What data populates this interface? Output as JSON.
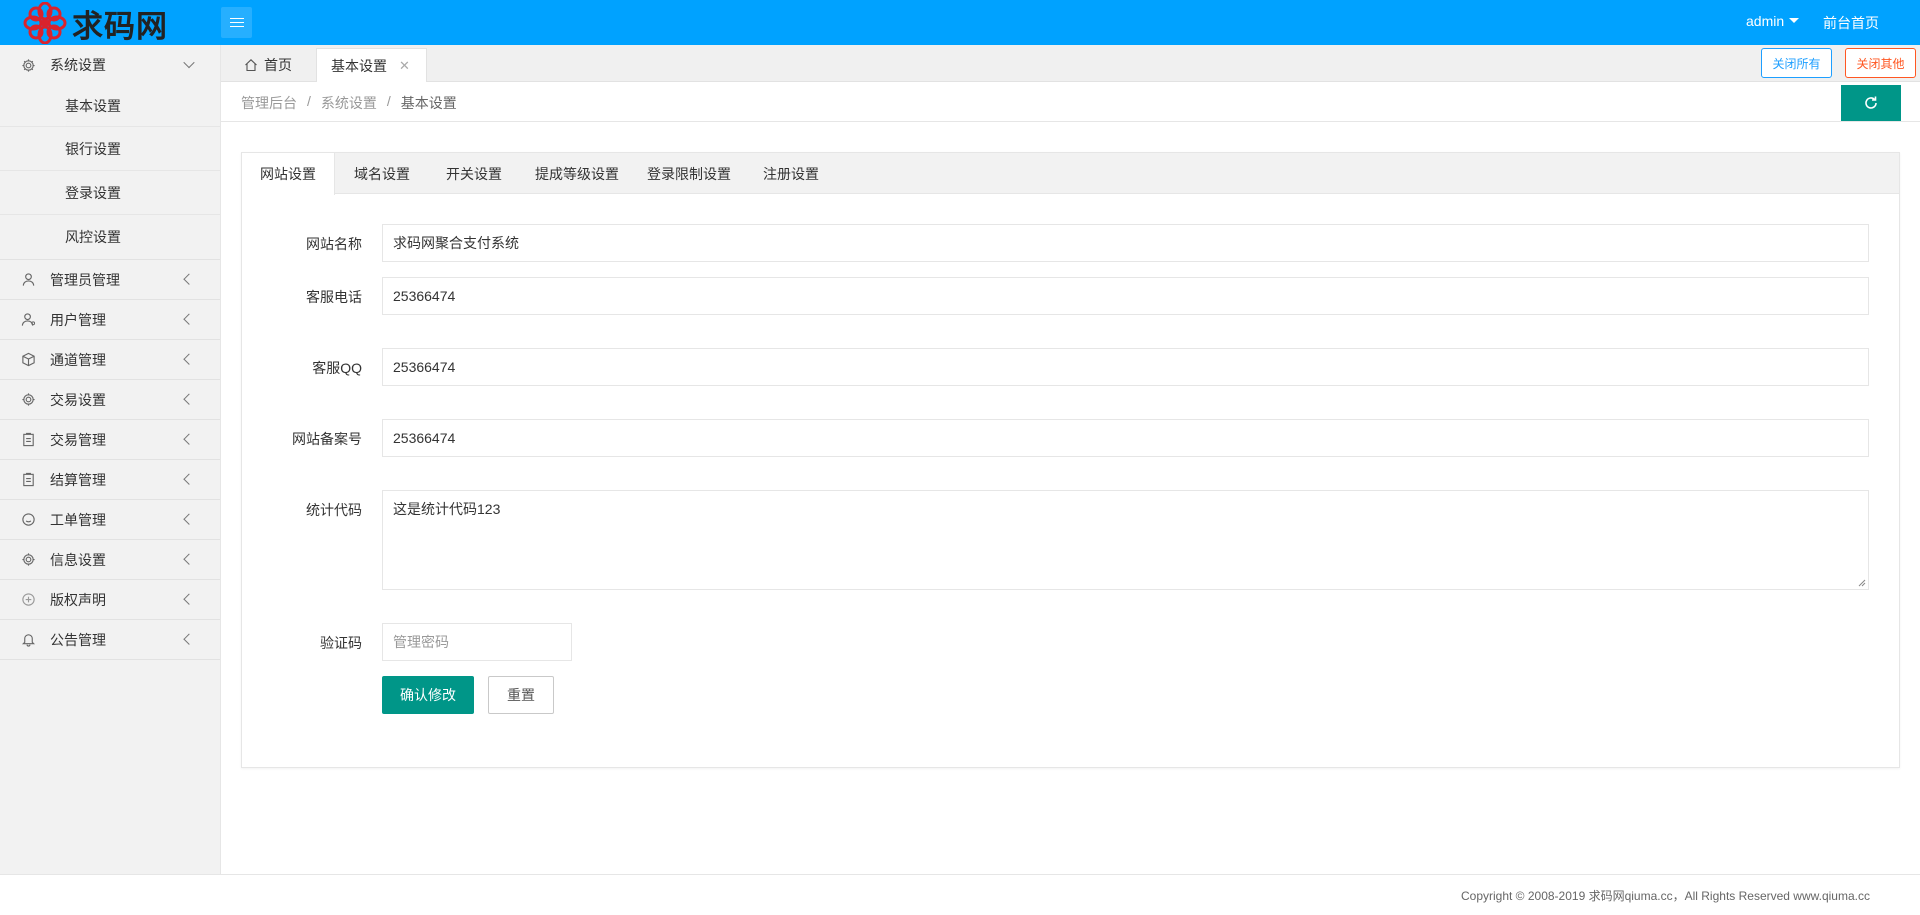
{
  "header": {
    "logo_text": "求码网",
    "user_name": "admin",
    "front_link": "前台首页"
  },
  "sidebar": {
    "system_settings": {
      "label": "系统设置",
      "icon": "gear-icon",
      "sub_items": [
        "基本设置",
        "银行设置",
        "登录设置",
        "风控设置"
      ]
    },
    "groups": [
      {
        "label": "管理员管理",
        "icon": "user-icon"
      },
      {
        "label": "用户管理",
        "icon": "users-icon"
      },
      {
        "label": "通道管理",
        "icon": "cube-icon"
      },
      {
        "label": "交易设置",
        "icon": "gear-icon"
      },
      {
        "label": "交易管理",
        "icon": "clipboard-icon"
      },
      {
        "label": "结算管理",
        "icon": "clipboard-icon"
      },
      {
        "label": "工单管理",
        "icon": "smile-icon"
      },
      {
        "label": "信息设置",
        "icon": "gear-icon"
      },
      {
        "label": "版权声明",
        "icon": "plus-circle-icon"
      },
      {
        "label": "公告管理",
        "icon": "bell-icon"
      }
    ]
  },
  "tabs": {
    "home": "首页",
    "active": "基本设置",
    "close_all": "关闭所有",
    "close_other": "关闭其他"
  },
  "breadcrumb": [
    "管理后台",
    "系统设置",
    "基本设置"
  ],
  "card_tabs": [
    "网站设置",
    "域名设置",
    "开关设置",
    "提成等级设置",
    "登录限制设置",
    "注册设置"
  ],
  "form": {
    "site_name": {
      "label": "网站名称",
      "value": "求码网聚合支付系统"
    },
    "service_phone": {
      "label": "客服电话",
      "value": "25366474"
    },
    "service_qq": {
      "label": "客服QQ",
      "value": "25366474"
    },
    "icp": {
      "label": "网站备案号",
      "value": "25366474"
    },
    "stats_code": {
      "label": "统计代码",
      "value": "这是统计代码123"
    },
    "captcha": {
      "label": "验证码",
      "placeholder": "管理密码"
    },
    "submit_label": "确认修改",
    "reset_label": "重置"
  },
  "footer": {
    "copyright": "Copyright © 2008-2019 求码网qiuma.cc，All Rights Reserved www.qiuma.cc"
  },
  "colors": {
    "header": "#00a2ff",
    "primary": "#009688",
    "close_all": "#1e9fff",
    "close_other": "#ff5722"
  }
}
